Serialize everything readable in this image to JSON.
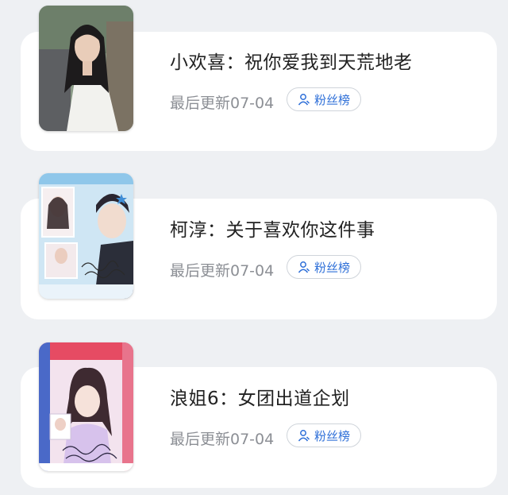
{
  "colors": {
    "accent": "#2e6fd8",
    "muted_text": "#8c8f95",
    "card_bg": "#ffffff",
    "page_bg": "#eef0f3"
  },
  "items": [
    {
      "title": "小欢喜：祝你爱我到天荒地老",
      "updated": "最后更新07-04",
      "badge_label": "粉丝榜",
      "badge_icon": "person-icon"
    },
    {
      "title": "柯淳：关于喜欢你这件事",
      "updated": "最后更新07-04",
      "badge_label": "粉丝榜",
      "badge_icon": "person-icon"
    },
    {
      "title": "浪姐6：女团出道企划",
      "updated": "最后更新07-04",
      "badge_label": "粉丝榜",
      "badge_icon": "person-icon"
    }
  ]
}
